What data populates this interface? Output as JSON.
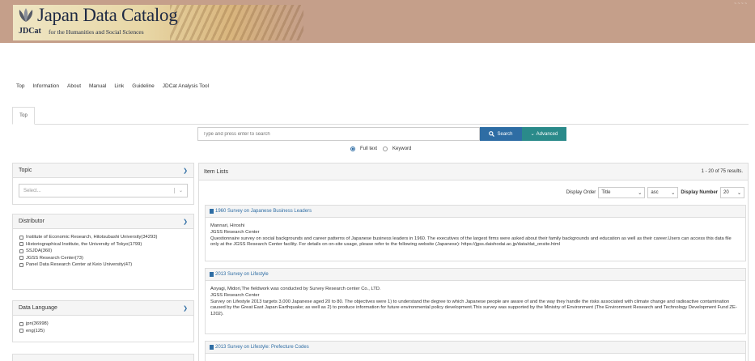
{
  "header": {
    "title": "Japan Data Catalog",
    "abbr": "JDCat",
    "subtitle": "for the Humanities and Social Sciences",
    "top_right": "~ ~ ~ ~"
  },
  "nav": [
    "Top",
    "Information",
    "About",
    "Manual",
    "Link",
    "Guideline",
    "JDCat Analysis Tool"
  ],
  "tabs": [
    {
      "label": "Top"
    }
  ],
  "search": {
    "placeholder": "Type and press enter to search",
    "search_label": "Search",
    "advanced_label": "Advanced",
    "options": [
      "Full text",
      "Keyword"
    ],
    "selected": "Full text"
  },
  "facets": {
    "topic": {
      "title": "Topic",
      "select_placeholder": "Select..."
    },
    "distributor": {
      "title": "Distributor",
      "items": [
        "Institute of Economic Research, Hitotsubashi University(34293)",
        "Historiographical Institute, the University of Tokyo(1799)",
        "SSJDA(360)",
        "JGSS Research Center(73)",
        "Panel Data Research Center at Keio University(47)"
      ]
    },
    "language": {
      "title": "Data Language",
      "items": [
        "jpn(36998)",
        "eng(125)"
      ]
    }
  },
  "list": {
    "title": "Item Lists",
    "count": "1 - 20 of 75 results.",
    "order_label": "Display Order",
    "order_value": "Title",
    "direction_value": "asc",
    "number_label": "Display Number",
    "number_value": "20",
    "records": [
      {
        "title": "1960 Survey on Japanese Business Leaders",
        "line1": "Mannari, Hiroshi",
        "line2": "JGSS Research Center",
        "desc": "Questionnaire survey on social backgrounds and career patterns of Japanese business leaders in 1960. The executives of the largest firms were asked about their family backgrounds and education as well as their career.Users can access this data file only at the JGSS Research Center facility. For details on on-site usage, please refer to the following website (Japanese): https://jgss.daishodai.ac.jp/data/dat_onsite.html"
      },
      {
        "title": "2013 Survey on Lifestyle",
        "line1": "Aoyagi, Midori,The fieldwork was conducted by Survey Research center Co., LTD.",
        "line2": "JGSS Research Center",
        "desc": "Survey on Lifestyle 2013 targets 3,000 Japanese aged 20 to 80. The objectives were 1) to understand the degree to which Japanese people are aware of and the way they handle the risks associated with climate change and radioactive contamination caused by the Great East Japan Earthquake; as well as 2) to produce information for future environmental policy development.This survey was supported by the Ministry of Environment (The Environment Research and Technology Development Fund ZE-1202)."
      },
      {
        "title": "2013 Survey on Lifestyle: Prefecture Codes",
        "line1": "",
        "line2": "",
        "desc": ""
      }
    ]
  }
}
